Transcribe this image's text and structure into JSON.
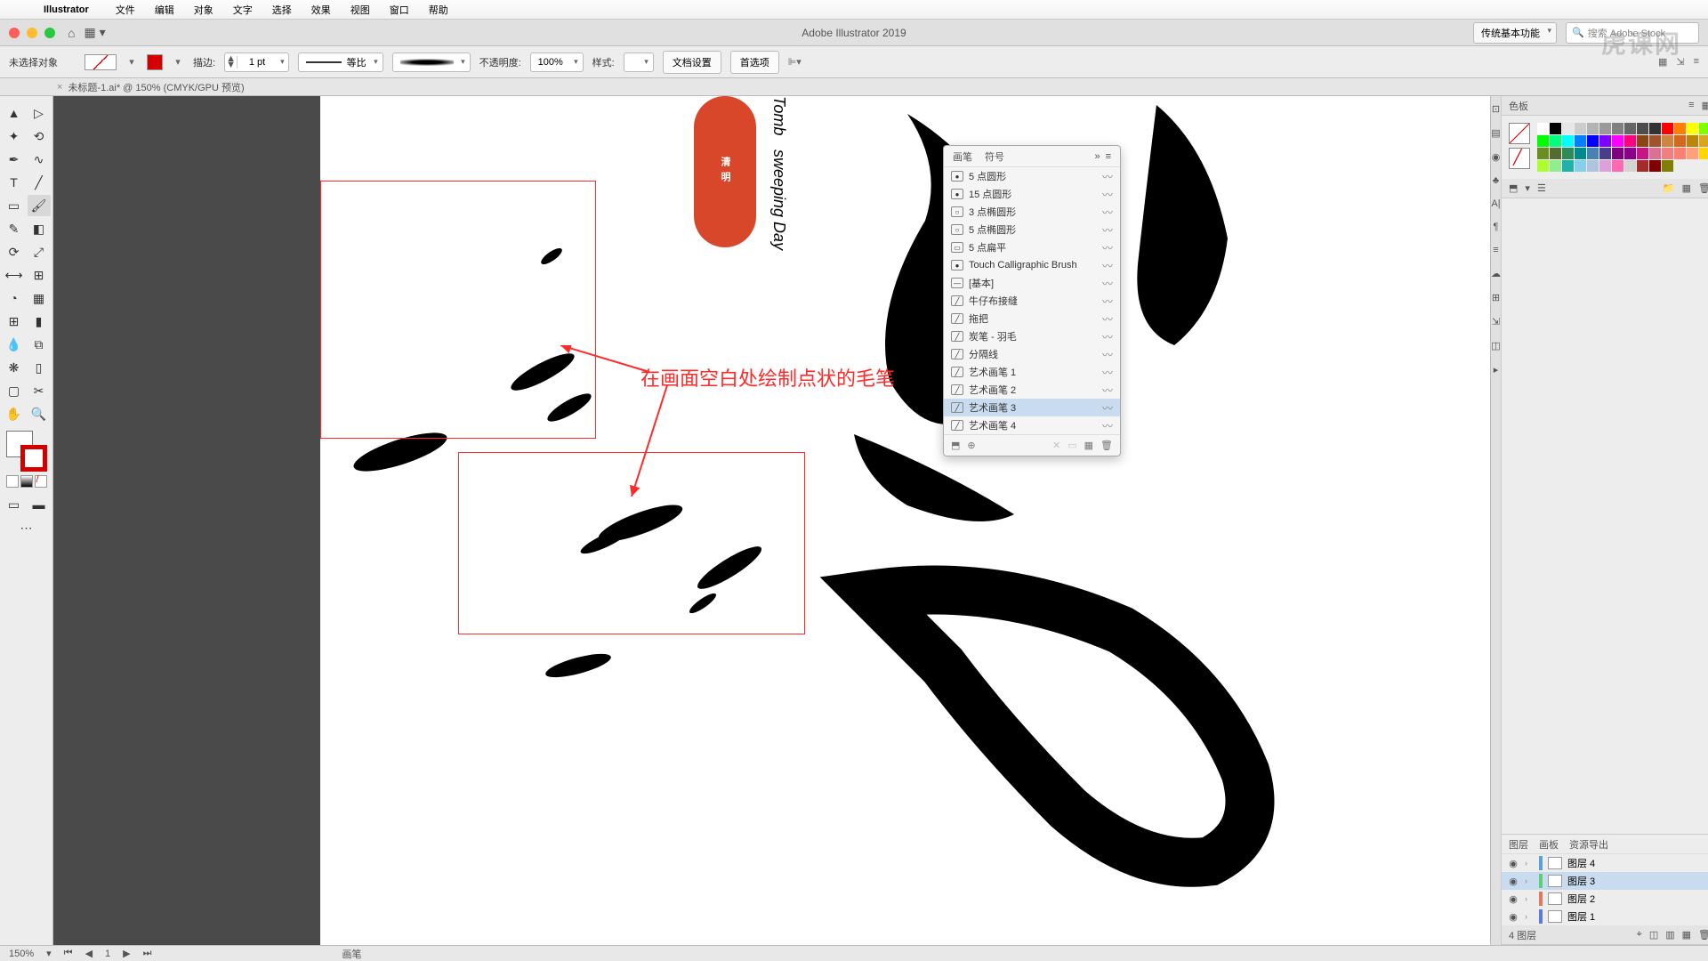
{
  "menubar": {
    "app": "Illustrator",
    "items": [
      "文件",
      "编辑",
      "对象",
      "文字",
      "选择",
      "效果",
      "视图",
      "窗口",
      "帮助"
    ]
  },
  "titlebar": {
    "title": "Adobe Illustrator 2019",
    "workspace": "传统基本功能",
    "search_ph": "搜索 Adobe Stock"
  },
  "controlbar": {
    "noselect": "未选择对象",
    "stroke_lbl": "描边:",
    "stroke_w": "1 pt",
    "profile": "等比",
    "opacity_lbl": "不透明度:",
    "opacity": "100%",
    "style_lbl": "样式:",
    "charset": "文档设置",
    "prefs": "首选项"
  },
  "tab": {
    "close": "×",
    "name": "未标题-1.ai* @ 150% (CMYK/GPU 预览)"
  },
  "annotation": "在画面空白处绘制点状的毛笔",
  "seal_text": "清明",
  "vtext1": "Tomb",
  "vtext2": "sweeping Day",
  "brushpanel": {
    "tabs": [
      "画笔",
      "符号"
    ],
    "items": [
      {
        "l": "5 点圆形",
        "i": "●"
      },
      {
        "l": "15 点圆形",
        "i": "●"
      },
      {
        "l": "3 点椭圆形",
        "i": "○"
      },
      {
        "l": "5 点椭圆形",
        "i": "○"
      },
      {
        "l": "5 点扁平",
        "i": "▭"
      },
      {
        "l": "Touch Calligraphic Brush",
        "i": "●"
      },
      {
        "l": "[基本]",
        "i": "—"
      },
      {
        "l": "牛仔布接缝",
        "i": "╱"
      },
      {
        "l": "拖把",
        "i": "╱"
      },
      {
        "l": "炭笔 - 羽毛",
        "i": "╱"
      },
      {
        "l": "分隔线",
        "i": "╱"
      },
      {
        "l": "艺术画笔 1",
        "i": "╱"
      },
      {
        "l": "艺术画笔 2",
        "i": "╱"
      },
      {
        "l": "艺术画笔 3",
        "i": "╱",
        "sel": true
      },
      {
        "l": "艺术画笔 4",
        "i": "╱"
      }
    ]
  },
  "swatches": {
    "title": "色板"
  },
  "layers": {
    "tabs": [
      "图层",
      "画板",
      "资源导出"
    ],
    "items": [
      {
        "name": "图层 4",
        "color": "#5aa0e0"
      },
      {
        "name": "图层 3",
        "color": "#5ad07a",
        "sel": true
      },
      {
        "name": "图层 2",
        "color": "#e07a5a"
      },
      {
        "name": "图层 1",
        "color": "#5a7ae0"
      }
    ],
    "footer": "4 图层"
  },
  "status": {
    "zoom": "150%",
    "page": "1",
    "mid": "画笔"
  },
  "watermark": "虎课网"
}
